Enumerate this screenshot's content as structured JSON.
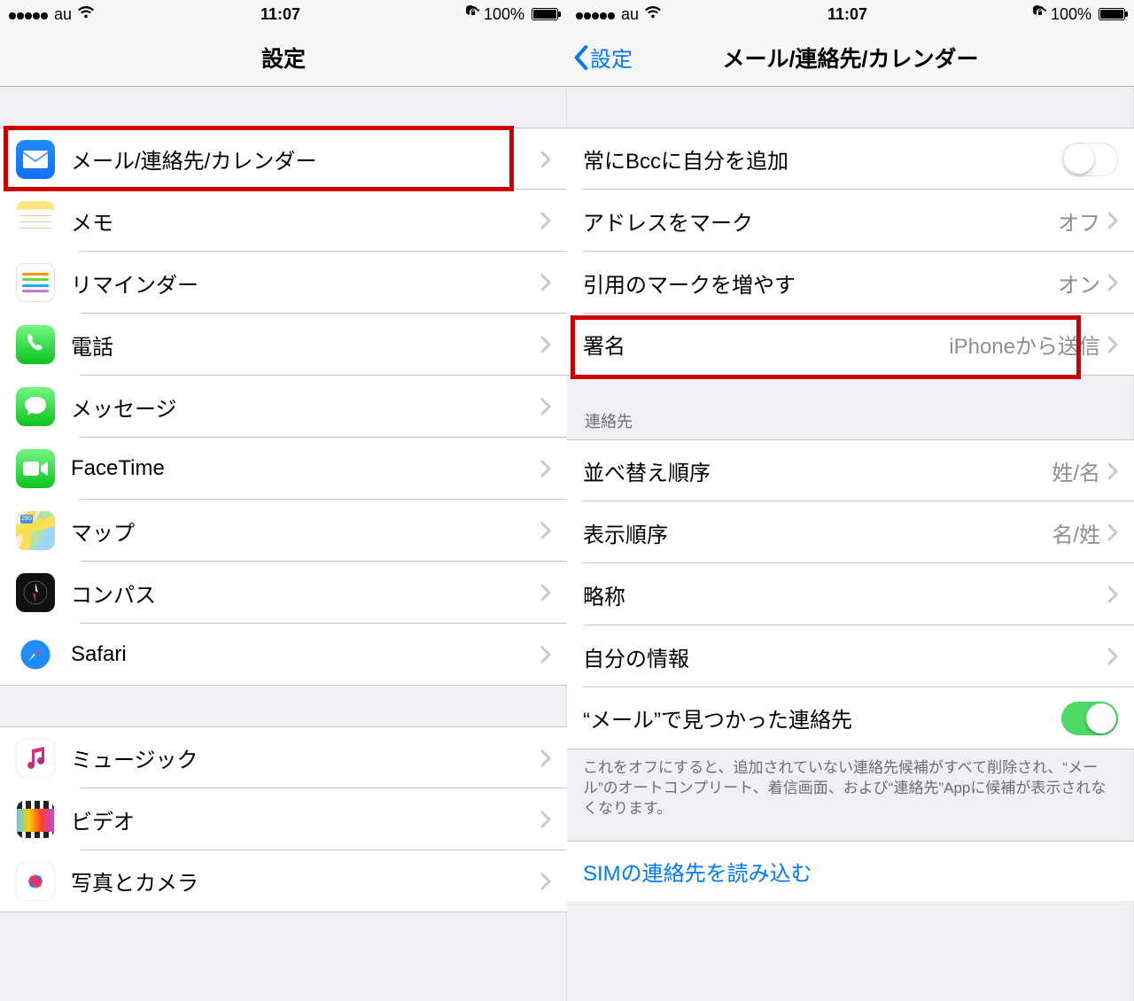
{
  "status": {
    "carrier": "au",
    "time": "11:07",
    "battery": "100%"
  },
  "left": {
    "title": "設定",
    "groups": [
      {
        "items": [
          {
            "id": "mail",
            "label": "メール/連絡先/カレンダー",
            "icon": "mail",
            "color": "linear-gradient(#1F8CFD,#1170F8)"
          },
          {
            "id": "notes",
            "label": "メモ",
            "icon": "notes",
            "color": "linear-gradient(#FFE26B,#FFCE00)"
          },
          {
            "id": "reminders",
            "label": "リマインダー",
            "icon": "reminders",
            "color": "#FFFFFF"
          },
          {
            "id": "phone",
            "label": "電話",
            "icon": "phone",
            "color": "linear-gradient(#74F684,#0BC31B)"
          },
          {
            "id": "messages",
            "label": "メッセージ",
            "icon": "messages",
            "color": "linear-gradient(#74F684,#0BC31B)"
          },
          {
            "id": "facetime",
            "label": "FaceTime",
            "icon": "facetime",
            "color": "linear-gradient(#74F684,#0BC31B)"
          },
          {
            "id": "maps",
            "label": "マップ",
            "icon": "maps",
            "color": "#fff"
          },
          {
            "id": "compass",
            "label": "コンパス",
            "icon": "compass",
            "color": "#111"
          },
          {
            "id": "safari",
            "label": "Safari",
            "icon": "safari",
            "color": "#fff"
          }
        ]
      },
      {
        "items": [
          {
            "id": "music",
            "label": "ミュージック",
            "icon": "music",
            "color": "#fff"
          },
          {
            "id": "video",
            "label": "ビデオ",
            "icon": "video",
            "color": "#fff"
          },
          {
            "id": "photos",
            "label": "写真とカメラ",
            "icon": "photos",
            "color": "#fff"
          }
        ]
      }
    ]
  },
  "right": {
    "back": "設定",
    "title": "メール/連絡先/カレンダー",
    "rows1": [
      {
        "id": "bcc",
        "label": "常にBccに自分を追加",
        "switch": "off"
      },
      {
        "id": "mark-addr",
        "label": "アドレスをマーク",
        "value": "オフ",
        "chevron": true
      },
      {
        "id": "quote",
        "label": "引用のマークを増やす",
        "value": "オン",
        "chevron": true
      },
      {
        "id": "signature",
        "label": "署名",
        "value": "iPhoneから送信",
        "chevron": true
      }
    ],
    "contacts_header": "連絡先",
    "rows2": [
      {
        "id": "sort",
        "label": "並べ替え順序",
        "value": "姓/名",
        "chevron": true
      },
      {
        "id": "display",
        "label": "表示順序",
        "value": "名/姓",
        "chevron": true
      },
      {
        "id": "short",
        "label": "略称",
        "chevron": true
      },
      {
        "id": "my-info",
        "label": "自分の情報",
        "chevron": true
      },
      {
        "id": "found-in-mail",
        "label": "“メール”で見つかった連絡先",
        "switch": "on"
      }
    ],
    "footer": "これをオフにすると、追加されていない連絡先候補がすべて削除され、“メール”のオートコンプリート、着信画面、および“連絡先”Appに候補が表示されなくなります。",
    "sim_link": "SIMの連絡先を読み込む"
  }
}
